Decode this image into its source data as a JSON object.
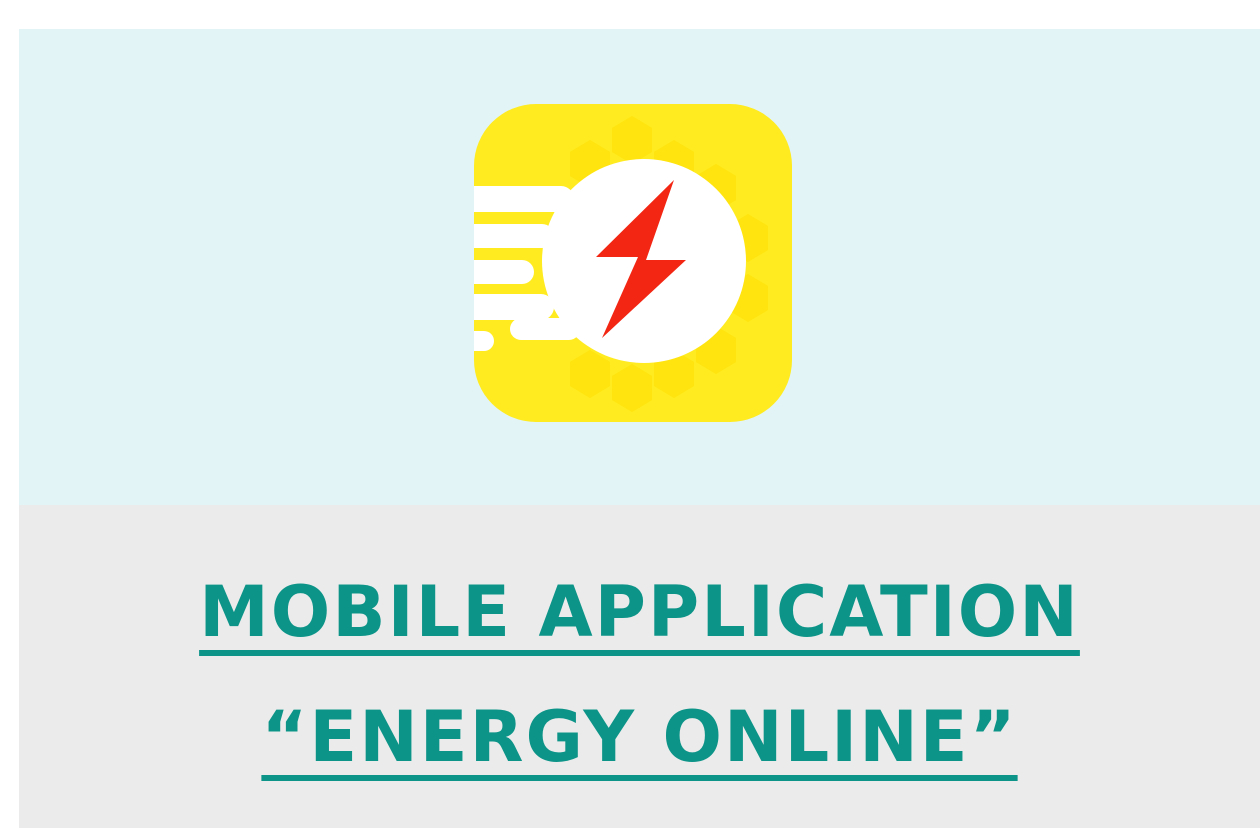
{
  "app_icon": {
    "icon": "lightning-bolt-icon",
    "background_color": "#FFEB1F",
    "bolt_color": "#F22613"
  },
  "title": {
    "line1": "MOBILE APPLICATION ",
    "line2": "“ENERGY ONLINE”",
    "color": "#0D9488"
  }
}
